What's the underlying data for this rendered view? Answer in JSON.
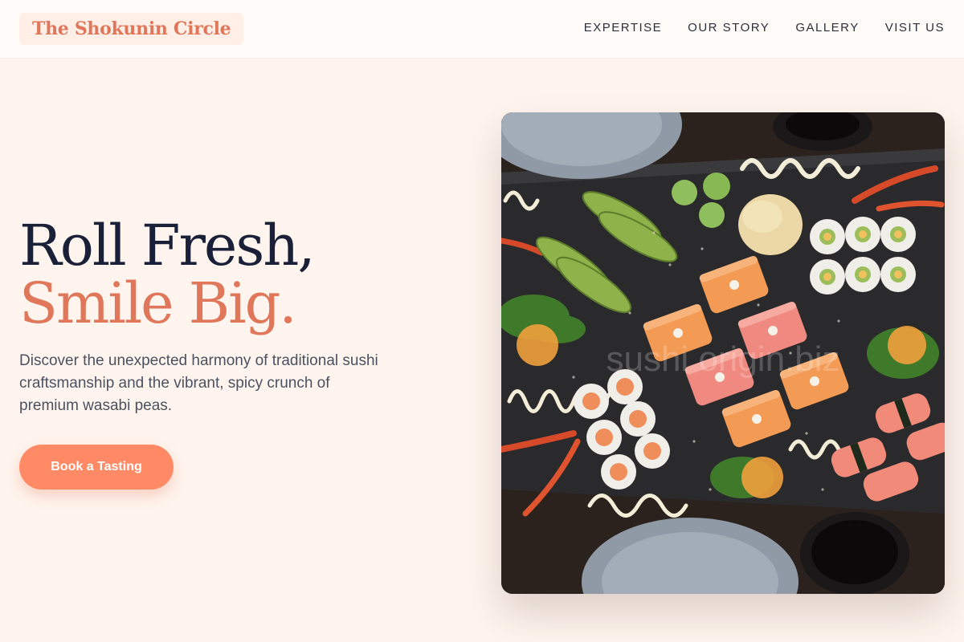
{
  "header": {
    "brand": "The Shokunin Circle",
    "nav": [
      "EXPERTISE",
      "OUR STORY",
      "GALLERY",
      "VISIT US"
    ]
  },
  "hero": {
    "headline_line1": "Roll Fresh,",
    "headline_line2": "Smile Big.",
    "subtitle": "Discover the unexpected harmony of traditional sushi craftsmanship and the vibrant, spicy crunch of premium wasabi peas.",
    "cta_label": "Book a Tasting"
  },
  "image": {
    "watermark": "sushi origin.biz"
  },
  "colors": {
    "accent": "#e0775a",
    "button": "#ff8a65",
    "headline_dark": "#1a2038",
    "background": "#fff5ee"
  }
}
